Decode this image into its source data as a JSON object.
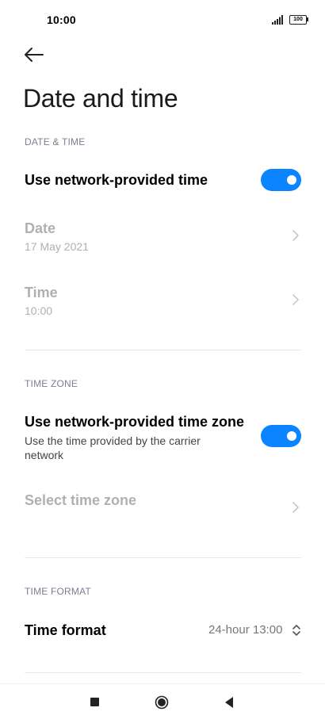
{
  "status_bar": {
    "time": "10:00",
    "battery": "100"
  },
  "header": {
    "title": "Date and time"
  },
  "sections": {
    "date_time": {
      "header": "DATE & TIME",
      "network_time": {
        "label": "Use network-provided time",
        "enabled": true
      },
      "date": {
        "label": "Date",
        "value": "17 May 2021"
      },
      "time": {
        "label": "Time",
        "value": "10:00"
      }
    },
    "time_zone": {
      "header": "TIME ZONE",
      "network_zone": {
        "label": "Use network-provided time zone",
        "description": "Use the time provided by the carrier network",
        "enabled": true
      },
      "select_zone": {
        "label": "Select time zone"
      }
    },
    "time_format": {
      "header": "TIME FORMAT",
      "format": {
        "label": "Time format",
        "value": "24-hour 13:00"
      }
    }
  },
  "colors": {
    "accent": "#0d84ff",
    "disabled_text": "#b0b0b0",
    "section_header": "#7a7f91"
  },
  "icons": {
    "back": "arrow-left-icon",
    "chevron": "chevron-right-icon",
    "updown": "chevron-up-down-icon",
    "nav_recents": "square-icon",
    "nav_home": "circle-icon",
    "nav_back": "triangle-left-icon"
  }
}
